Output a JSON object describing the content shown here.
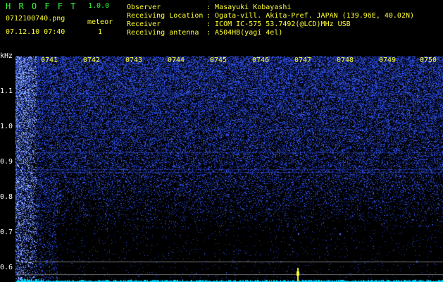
{
  "header": {
    "app_name": "H R O F F T",
    "version": "1.0.0",
    "filename": "0712100740.png",
    "timestamp": "07.12.10 07:40",
    "meteor_label": "meteor",
    "meteor_count": "1"
  },
  "info": {
    "rows": [
      {
        "label": "Observer",
        "value": ": Masayuki Kobayashi"
      },
      {
        "label": "Receiving Location",
        "value": ": Ogata-vill. Akita-Pref. JAPAN (139.96E, 40.02N)"
      },
      {
        "label": "Receiver",
        "value": ": ICOM IC-575 53.7492(@LCD)MHz USB"
      },
      {
        "label": "Receiving antenna",
        "value": ": A504HB(yagi 4el)"
      }
    ]
  },
  "spectrogram": {
    "y_unit": "kHz",
    "time_ticks": [
      "0741",
      "0742",
      "0743",
      "0744",
      "0745",
      "0746",
      "0747",
      "0748",
      "0749",
      "0750"
    ],
    "freq_ticks": [
      "1.1",
      "1.0",
      "0.9",
      "0.8",
      "0.7",
      "0.6"
    ],
    "colors": {
      "noise": "#1f3dff",
      "bright": "#9fb7ff",
      "meteor": "#ffff33",
      "baseline": "#00d7ff"
    }
  }
}
